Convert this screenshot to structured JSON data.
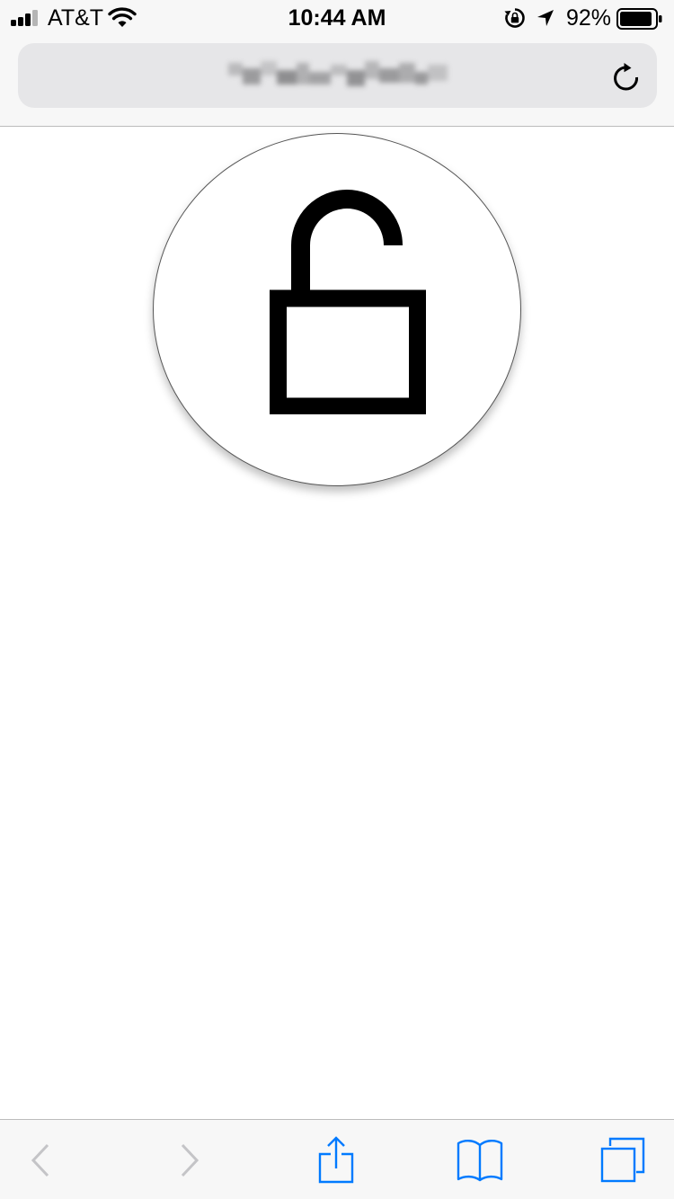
{
  "status_bar": {
    "carrier": "AT&T",
    "time": "10:44 AM",
    "battery_percent": "92%",
    "battery_level": 0.92,
    "signal_bars": 3,
    "signal_bars_total": 4,
    "icons": [
      "signal-icon",
      "wifi-icon",
      "orientation-lock-icon",
      "location-arrow-icon",
      "battery-icon"
    ]
  },
  "url_bar": {
    "url_text": "",
    "reload_icon": "reload-icon"
  },
  "content": {
    "icon": "unlocked-padlock-icon"
  },
  "toolbar": {
    "items": [
      "back-icon",
      "forward-icon",
      "share-icon",
      "bookmarks-icon",
      "tabs-icon"
    ]
  },
  "colors": {
    "accent": "#007aff",
    "disabled": "#c4c4c7",
    "chrome_bg": "#f7f7f7",
    "url_field_bg": "#e6e6e8"
  }
}
